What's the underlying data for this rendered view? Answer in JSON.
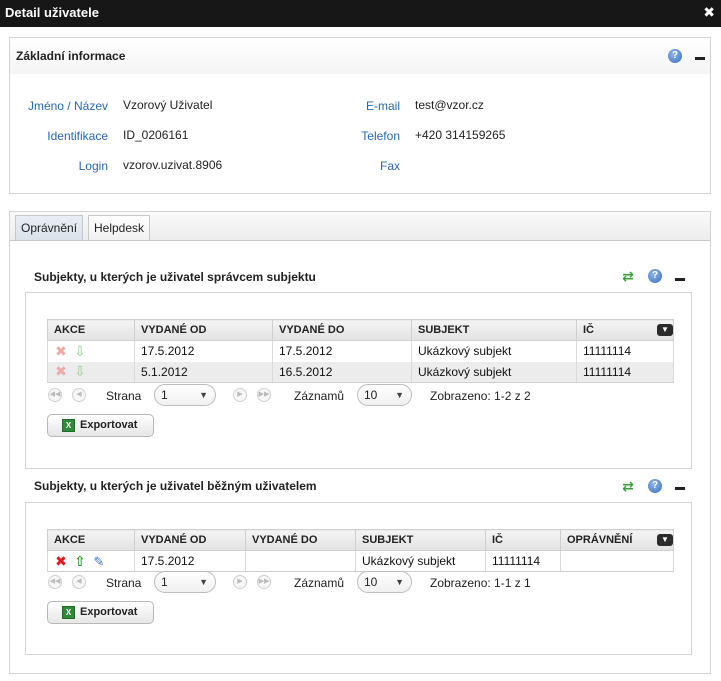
{
  "window": {
    "title": "Detail uživatele",
    "close_glyph": "✖"
  },
  "basic_info": {
    "title": "Základní informace",
    "left": [
      {
        "label": "Jméno / Název",
        "value": "Vzorový Uživatel"
      },
      {
        "label": "Identifikace",
        "value": "ID_0206161"
      },
      {
        "label": "Login",
        "value": "vzorov.uzivat.8906"
      }
    ],
    "right": [
      {
        "label": "E-mail",
        "value": "test@vzor.cz"
      },
      {
        "label": "Telefon",
        "value": "+420 314159265"
      },
      {
        "label": "Fax",
        "value": ""
      }
    ]
  },
  "tabs": [
    {
      "label": "Oprávnění",
      "active": true
    },
    {
      "label": "Helpdesk",
      "active": false
    }
  ],
  "section_admin": {
    "title": "Subjekty, u kterých je uživatel správcem subjektu",
    "columns": [
      "AKCE",
      "VYDANÉ OD",
      "VYDANÉ DO",
      "SUBJEKT",
      "IČ"
    ],
    "rows": [
      {
        "from": "17.5.2012",
        "to": "17.5.2012",
        "subject": "Ukázkový subjekt",
        "ic": "11111114"
      },
      {
        "from": "5.1.2012",
        "to": "16.5.2012",
        "subject": "Ukázkový subjekt",
        "ic": "11111114"
      }
    ],
    "pager": {
      "page_label": "Strana",
      "page_value": "1",
      "records_label": "Záznamů",
      "records_value": "10",
      "shown": "Zobrazeno: 1-2 z 2"
    },
    "export_label": "Exportovat"
  },
  "section_user": {
    "title": "Subjekty, u kterých je uživatel běžným uživatelem",
    "columns": [
      "AKCE",
      "VYDANÉ OD",
      "VYDANÉ DO",
      "SUBJEKT",
      "IČ",
      "OPRÁVNĚNÍ"
    ],
    "rows": [
      {
        "from": "17.5.2012",
        "to": "",
        "subject": "Ukázkový subjekt",
        "ic": "11111114",
        "permission": ""
      }
    ],
    "pager": {
      "page_label": "Strana",
      "page_value": "1",
      "records_label": "Záznamů",
      "records_value": "10",
      "shown": "Zobrazeno: 1-1 z 1"
    },
    "export_label": "Exportovat"
  },
  "icons": {
    "help": "?",
    "refresh": "⇄",
    "delete": "✖",
    "arrow_down": "⇩",
    "arrow_up": "⇧",
    "edit": "✎",
    "column_menu": "▼",
    "first": "◀◀",
    "prev": "◀",
    "next": "▶",
    "last": "▶▶",
    "dropdown": "▼",
    "excel": "X"
  },
  "colors": {
    "titlebar": "#171717",
    "link_label": "#2a68b0",
    "help": "#3a6fc2",
    "refresh": "#3aa03a",
    "delete": "#e01818"
  }
}
